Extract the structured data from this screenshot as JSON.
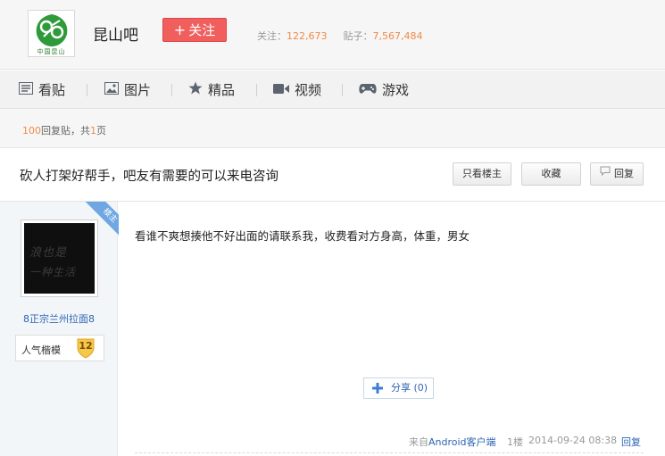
{
  "header": {
    "logo_caption": "中国昆山",
    "forum_name": "昆山吧",
    "follow_label": "关注",
    "follow_prefix": "+",
    "stats": {
      "follow_label": "关注：",
      "follow_count": "122,673",
      "posts_label": "贴子：",
      "posts_count": "7,567,484"
    }
  },
  "tabs": [
    {
      "label": "看贴",
      "icon": "list-icon"
    },
    {
      "label": "图片",
      "icon": "image-icon"
    },
    {
      "label": "精品",
      "icon": "star-icon"
    },
    {
      "label": "视频",
      "icon": "video-icon"
    },
    {
      "label": "游戏",
      "icon": "gamepad-icon"
    }
  ],
  "reply_bar": {
    "count": "100",
    "count_suffix": "回复贴，共",
    "pages": "1",
    "pages_suffix": "页"
  },
  "thread": {
    "title": "砍人打架好帮手，吧友有需要的可以来电咨询",
    "only_author_label": "只看楼主",
    "favorite_label": "收藏",
    "reply_label": "回复"
  },
  "post": {
    "badge": "楼主",
    "author_name": "8正宗兰州拉面8",
    "avatar_text": [
      "浪也是",
      "一种生活"
    ],
    "rank_title": "人气楷模",
    "rank_level": "12",
    "content": "看谁不爽想揍他不好出面的请联系我，收费看对方身高，体重，男女",
    "share_label": "分享",
    "share_count": "(0)",
    "source_prefix": "来自",
    "source_client": "Android客户端",
    "floor": "1楼",
    "timestamp": "2014-09-24 08:38",
    "reply_link": "回复"
  },
  "colors": {
    "accent_red": "#f05e5e",
    "link_blue": "#2d64b3",
    "stat_orange": "#f08a49",
    "badge_blue": "#6fa7e3"
  }
}
